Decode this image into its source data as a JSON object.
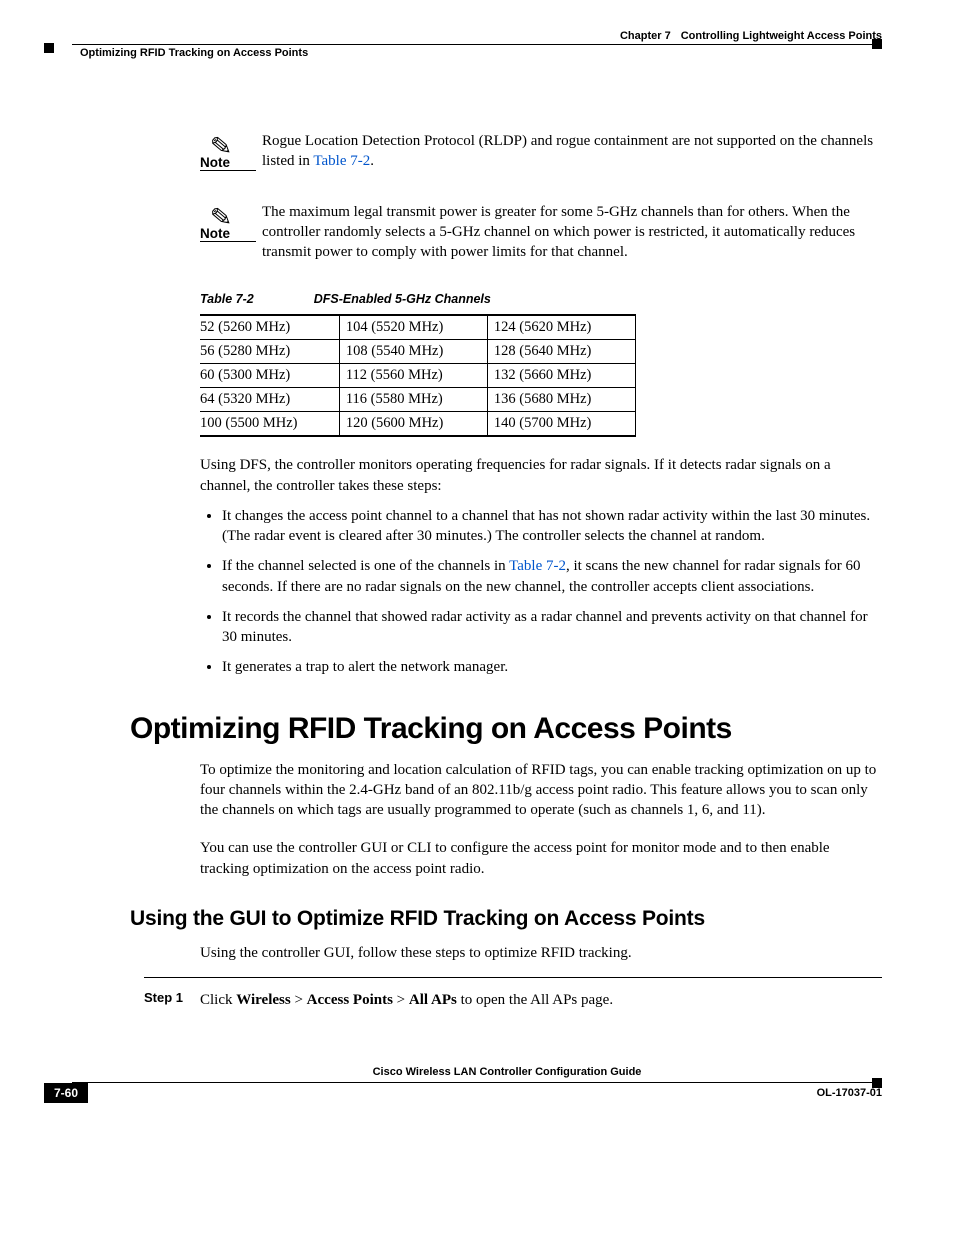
{
  "header": {
    "chapter_label": "Chapter 7",
    "chapter_title": "Controlling Lightweight Access Points",
    "section_running": "Optimizing RFID Tracking on Access Points"
  },
  "notes": [
    {
      "label": "Note",
      "text_pre": "Rogue Location Detection Protocol (RLDP) and rogue containment are not supported on the channels listed in ",
      "xref": "Table 7-2",
      "text_post": "."
    },
    {
      "label": "Note",
      "text": "The maximum legal transmit power is greater for some 5-GHz channels than for others. When the controller randomly selects a 5-GHz channel on which power is restricted, it automatically reduces transmit power to comply with power limits for that channel."
    }
  ],
  "table": {
    "number": "Table 7-2",
    "title": "DFS-Enabled 5-GHz Channels",
    "rows": [
      [
        "52 (5260 MHz)",
        "104 (5520 MHz)",
        "124 (5620 MHz)"
      ],
      [
        "56 (5280 MHz)",
        "108 (5540 MHz)",
        "128 (5640 MHz)"
      ],
      [
        "60 (5300 MHz)",
        "112 (5560 MHz)",
        "132 (5660 MHz)"
      ],
      [
        "64 (5320 MHz)",
        "116 (5580 MHz)",
        "136 (5680 MHz)"
      ],
      [
        "100 (5500 MHz)",
        "120 (5600 MHz)",
        "140 (5700 MHz)"
      ]
    ]
  },
  "para1": "Using DFS, the controller monitors operating frequencies for radar signals. If it detects radar signals on a channel, the controller takes these steps:",
  "bullets": [
    "It changes the access point channel to a channel that has not shown radar activity within the last 30 minutes. (The radar event is cleared after 30 minutes.) The controller selects the channel at random.",
    {
      "pre": "If the channel selected is one of the channels in ",
      "xref": "Table 7-2",
      "post": ", it scans the new channel for radar signals for 60 seconds. If there are no radar signals on the new channel, the controller accepts client associations."
    },
    "It records the channel that showed radar activity as a radar channel and prevents activity on that channel for 30 minutes.",
    "It generates a trap to alert the network manager."
  ],
  "h1": "Optimizing RFID Tracking on Access Points",
  "para2": "To optimize the monitoring and location calculation of RFID tags, you can enable tracking optimization on up to four channels within the 2.4-GHz band of an 802.11b/g access point radio. This feature allows you to scan only the channels on which tags are usually programmed to operate (such as channels 1, 6, and 11).",
  "para3": "You can use the controller GUI or CLI to configure the access point for monitor mode and to then enable tracking optimization on the access point radio.",
  "h2": "Using the GUI to Optimize RFID Tracking on Access Points",
  "para4": "Using the controller GUI, follow these steps to optimize RFID tracking.",
  "step": {
    "label": "Step 1",
    "pre": "Click ",
    "b1": "Wireless",
    "s1": " > ",
    "b2": "Access Points",
    "s2": " > ",
    "b3": "All APs",
    "post": " to open the All APs page."
  },
  "footer": {
    "guide": "Cisco Wireless LAN Controller Configuration Guide",
    "page": "7-60",
    "docid": "OL-17037-01"
  }
}
